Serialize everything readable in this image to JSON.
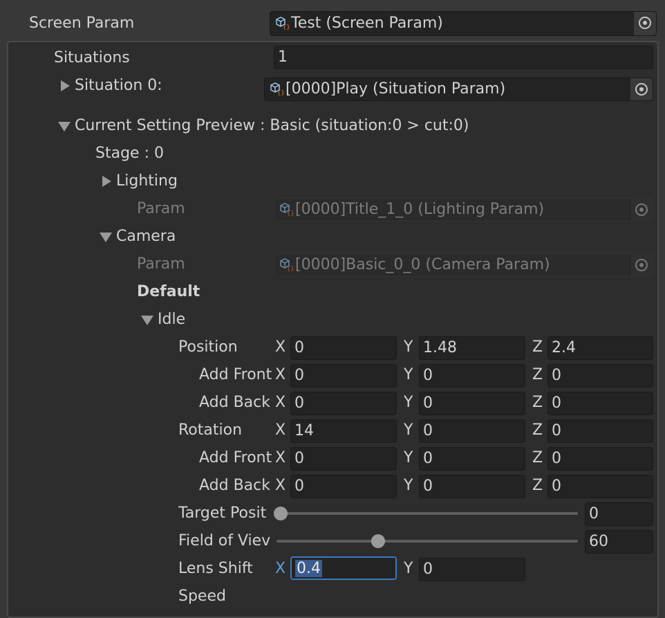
{
  "screen_param": {
    "label": "Screen Param",
    "value": "Test (Screen Param)"
  },
  "situations": {
    "label": "Situations",
    "value": "1"
  },
  "situation0": {
    "label": "Situation 0:",
    "value": "[0000]Play (Situation Param)"
  },
  "preview": {
    "label": "Current Setting Preview : Basic (situation:0 > cut:0)",
    "stage": "Stage : 0",
    "lighting": {
      "label": "Lighting",
      "param_label": "Param",
      "param_value": "[0000]Title_1_0 (Lighting Param)"
    },
    "camera": {
      "label": "Camera",
      "param_label": "Param",
      "param_value": "[0000]Basic_0_0 (Camera Param)",
      "default_label": "Default",
      "idle_label": "Idle"
    }
  },
  "vectors": [
    {
      "label": "Position",
      "x": "0",
      "y": "1.48",
      "z": "2.4"
    },
    {
      "label": "Add Front",
      "x": "0",
      "y": "0",
      "z": "0"
    },
    {
      "label": "Add Back",
      "x": "0",
      "y": "0",
      "z": "0"
    },
    {
      "label": "Rotation",
      "x": "14",
      "y": "0",
      "z": "0"
    },
    {
      "label": "Add Front",
      "x": "0",
      "y": "0",
      "z": "0"
    },
    {
      "label": "Add Back",
      "x": "0",
      "y": "0",
      "z": "0"
    }
  ],
  "axes": {
    "x": "X",
    "y": "Y",
    "z": "Z"
  },
  "target_position": {
    "label": "Target Posit",
    "value": "0",
    "fraction": 0.0
  },
  "field_of_view": {
    "label": "Field of Viev",
    "value": "60",
    "fraction": 0.34
  },
  "lens_shift": {
    "label": "Lens Shift",
    "x": "0.4",
    "y": "0"
  },
  "speed": {
    "label": "Speed"
  },
  "colors": {
    "background": "#383838",
    "panel": "#2d2d2d",
    "field": "#232323",
    "active_border": "#3a79bb",
    "selection": "#3a5c8f"
  },
  "icons": {
    "object": "scriptable-object-icon",
    "picker": "object-picker-icon",
    "foldout_closed": "triangle-right-icon",
    "foldout_open": "triangle-down-icon"
  }
}
